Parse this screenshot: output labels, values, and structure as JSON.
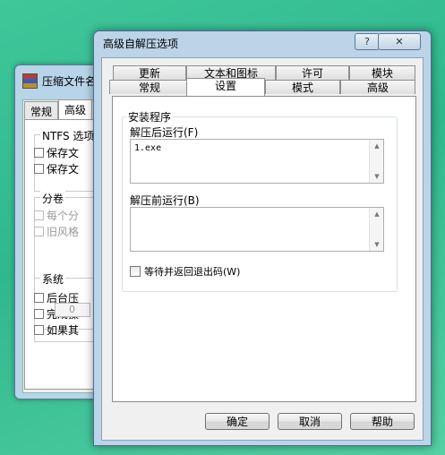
{
  "background_window": {
    "title": "压缩文件名",
    "tabs": [
      "常规",
      "高级"
    ],
    "ntfs_group": "NTFS 选项",
    "ntfs_items": [
      "保存文",
      "保存文"
    ],
    "split_group": "分卷",
    "split_items": [
      "每个分",
      "旧风格"
    ],
    "split_spin_value": "0",
    "system_group": "系统",
    "system_items": [
      "后台压",
      "完成操",
      "如果其"
    ]
  },
  "dialog": {
    "title": "高级自解压选项",
    "help_label": "?",
    "close_label": "✕",
    "tabs_row1": [
      "更新",
      "文本和图标",
      "许可",
      "模块"
    ],
    "tabs_row2": [
      "常规",
      "设置",
      "模式",
      "高级"
    ],
    "group_label": "安装程序",
    "run_after_label": "解压后运行(F)",
    "run_after_value": "1.exe",
    "run_before_label": "解压前运行(B)",
    "run_before_value": "",
    "wait_label": "等待并返回退出码(W)",
    "ok_button": "确定",
    "cancel_button": "取消",
    "help_button": "帮助"
  }
}
